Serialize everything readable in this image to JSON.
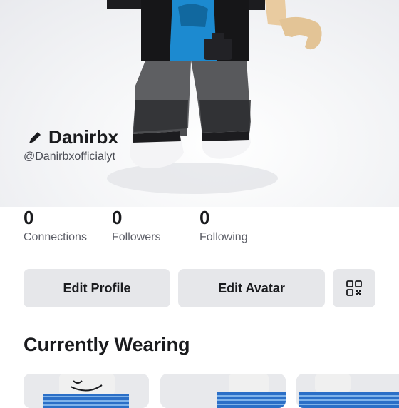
{
  "profile": {
    "display_name": "Danirbx",
    "username": "@Danirbxofficialyt",
    "edit_icon": "pencil-icon"
  },
  "stats": [
    {
      "value": "0",
      "label": "Connections"
    },
    {
      "value": "0",
      "label": "Followers"
    },
    {
      "value": "0",
      "label": "Following"
    }
  ],
  "actions": {
    "edit_profile": "Edit Profile",
    "edit_avatar": "Edit Avatar",
    "qr_icon": "qr-code-icon"
  },
  "wearing": {
    "title": "Currently Wearing"
  },
  "colors": {
    "button_bg": "#e6e7ea",
    "text": "#1a1b1e",
    "muted": "#5b5d66"
  }
}
